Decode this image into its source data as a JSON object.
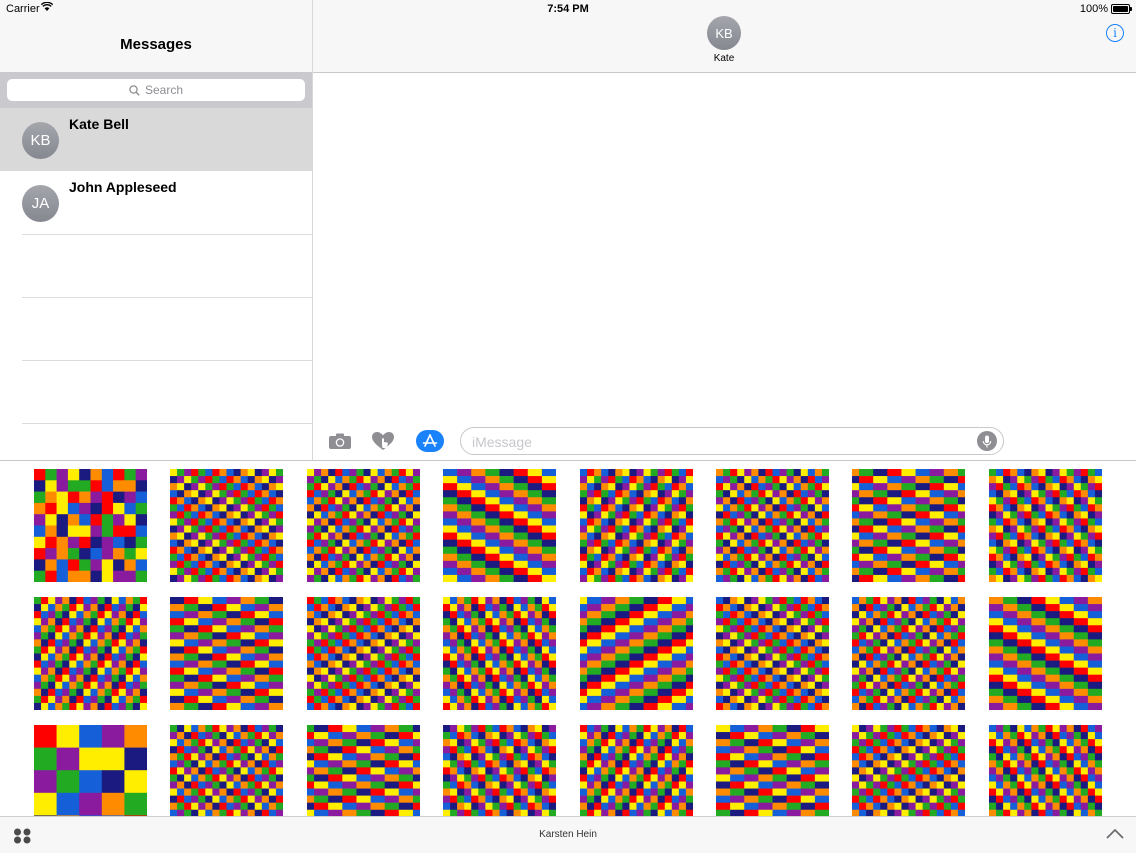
{
  "status_bar": {
    "carrier": "Carrier",
    "time": "7:54 PM",
    "battery": "100%"
  },
  "sidebar": {
    "title": "Messages",
    "search_placeholder": "Search",
    "conversations": [
      {
        "initials": "KB",
        "name": "Kate Bell",
        "selected": true
      },
      {
        "initials": "JA",
        "name": "John Appleseed",
        "selected": false
      }
    ]
  },
  "chat": {
    "contact_initials": "KB",
    "contact_name": "Kate",
    "input_placeholder": "iMessage"
  },
  "drawer": {
    "app_title": "Karsten Hein",
    "sticker_count": 24,
    "palette": [
      "#ff0000",
      "#ff8c00",
      "#ffee00",
      "#22aa22",
      "#1560d8",
      "#1a1a80",
      "#8a1a9e"
    ]
  },
  "colors": {
    "accent": "#1a82fb",
    "avatar": "#8e9097",
    "selected_row": "#d9d9d9"
  },
  "icons": {
    "camera": "camera-icon",
    "digital_touch": "digital-touch-icon",
    "app_store": "app-store-icon",
    "mic": "microphone-icon",
    "info": "info-icon",
    "apps_grid": "apps-grid-icon",
    "expand": "chevron-up-icon"
  }
}
